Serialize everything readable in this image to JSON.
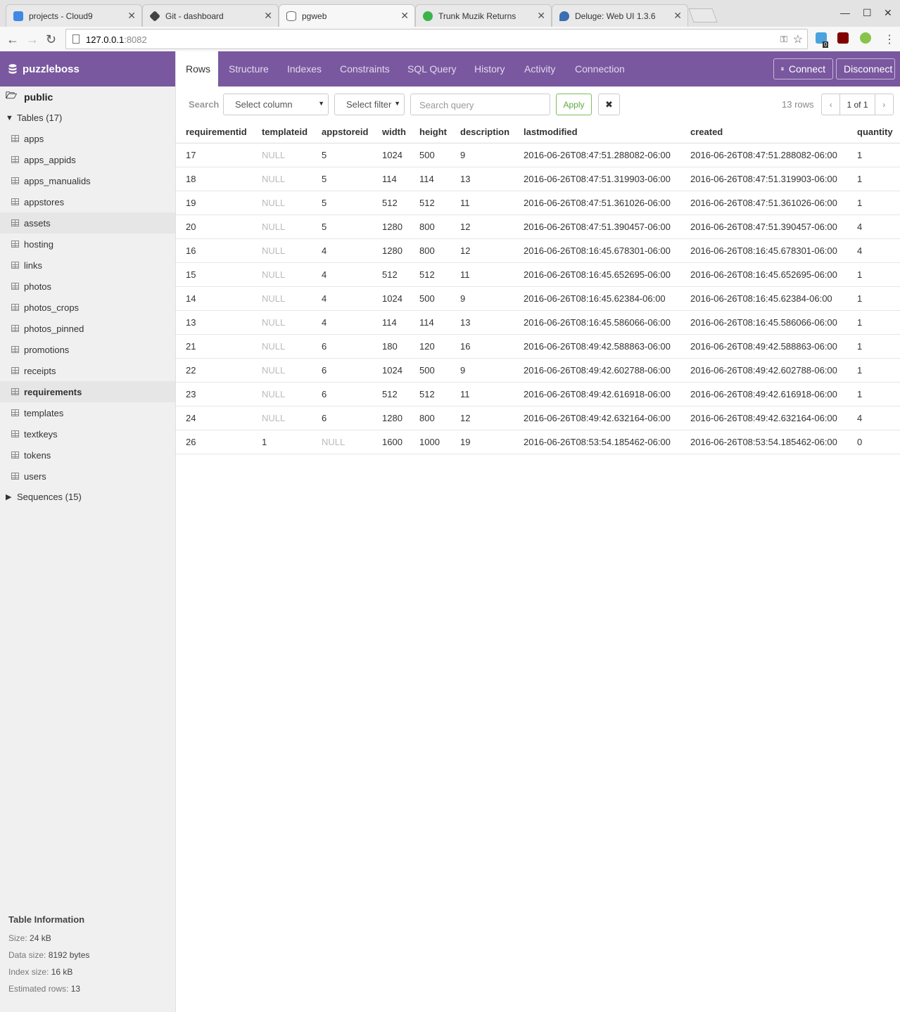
{
  "browser": {
    "tabs": [
      {
        "title": "projects - Cloud9",
        "icon": "cloud9-icon",
        "color": "#3f88e6"
      },
      {
        "title": "Git - dashboard",
        "icon": "git-icon",
        "color": "#444444"
      },
      {
        "title": "pgweb",
        "icon": "database-icon",
        "color": "#666666"
      },
      {
        "title": "Trunk Muzik Returns",
        "icon": "play-icon",
        "color": "#3cb44b"
      },
      {
        "title": "Deluge: Web UI 1.3.6",
        "icon": "deluge-icon",
        "color": "#3a6fb0"
      }
    ],
    "url_host": "127.0.0.1",
    "url_port": ":8082",
    "ext_badge": "0"
  },
  "sidebar": {
    "database": "puzzleboss",
    "schema": "public",
    "tables_label": "Tables (17)",
    "tables": [
      "apps",
      "apps_appids",
      "apps_manualids",
      "appstores",
      "assets",
      "hosting",
      "links",
      "photos",
      "photos_crops",
      "photos_pinned",
      "promotions",
      "receipts",
      "requirements",
      "templates",
      "textkeys",
      "tokens",
      "users"
    ],
    "selected_table": "requirements",
    "sequences_label": "Sequences (15)",
    "info": {
      "title": "Table Information",
      "size_label": "Size:",
      "size": "24 kB",
      "data_size_label": "Data size:",
      "data_size": "8192 bytes",
      "index_size_label": "Index size:",
      "index_size": "16 kB",
      "est_rows_label": "Estimated rows:",
      "est_rows": "13"
    }
  },
  "nav": {
    "tabs": [
      "Rows",
      "Structure",
      "Indexes",
      "Constraints",
      "SQL Query",
      "History",
      "Activity",
      "Connection"
    ],
    "active": "Rows",
    "connect_label": "Connect",
    "disconnect_label": "Disconnect"
  },
  "search": {
    "label": "Search",
    "column_select": "Select column",
    "filter_select": "Select filter",
    "query_placeholder": "Search query",
    "apply_label": "Apply",
    "clear_icon": "✖",
    "row_count": "13 rows",
    "page_info": "1 of 1"
  },
  "table": {
    "columns": [
      "requirementid",
      "templateid",
      "appstoreid",
      "width",
      "height",
      "description",
      "lastmodified",
      "created",
      "quantity"
    ],
    "rows": [
      [
        "17",
        "NULL",
        "5",
        "1024",
        "500",
        "9",
        "2016-06-26T08:47:51.288082-06:00",
        "2016-06-26T08:47:51.288082-06:00",
        "1"
      ],
      [
        "18",
        "NULL",
        "5",
        "114",
        "114",
        "13",
        "2016-06-26T08:47:51.319903-06:00",
        "2016-06-26T08:47:51.319903-06:00",
        "1"
      ],
      [
        "19",
        "NULL",
        "5",
        "512",
        "512",
        "11",
        "2016-06-26T08:47:51.361026-06:00",
        "2016-06-26T08:47:51.361026-06:00",
        "1"
      ],
      [
        "20",
        "NULL",
        "5",
        "1280",
        "800",
        "12",
        "2016-06-26T08:47:51.390457-06:00",
        "2016-06-26T08:47:51.390457-06:00",
        "4"
      ],
      [
        "16",
        "NULL",
        "4",
        "1280",
        "800",
        "12",
        "2016-06-26T08:16:45.678301-06:00",
        "2016-06-26T08:16:45.678301-06:00",
        "4"
      ],
      [
        "15",
        "NULL",
        "4",
        "512",
        "512",
        "11",
        "2016-06-26T08:16:45.652695-06:00",
        "2016-06-26T08:16:45.652695-06:00",
        "1"
      ],
      [
        "14",
        "NULL",
        "4",
        "1024",
        "500",
        "9",
        "2016-06-26T08:16:45.62384-06:00",
        "2016-06-26T08:16:45.62384-06:00",
        "1"
      ],
      [
        "13",
        "NULL",
        "4",
        "114",
        "114",
        "13",
        "2016-06-26T08:16:45.586066-06:00",
        "2016-06-26T08:16:45.586066-06:00",
        "1"
      ],
      [
        "21",
        "NULL",
        "6",
        "180",
        "120",
        "16",
        "2016-06-26T08:49:42.588863-06:00",
        "2016-06-26T08:49:42.588863-06:00",
        "1"
      ],
      [
        "22",
        "NULL",
        "6",
        "1024",
        "500",
        "9",
        "2016-06-26T08:49:42.602788-06:00",
        "2016-06-26T08:49:42.602788-06:00",
        "1"
      ],
      [
        "23",
        "NULL",
        "6",
        "512",
        "512",
        "11",
        "2016-06-26T08:49:42.616918-06:00",
        "2016-06-26T08:49:42.616918-06:00",
        "1"
      ],
      [
        "24",
        "NULL",
        "6",
        "1280",
        "800",
        "12",
        "2016-06-26T08:49:42.632164-06:00",
        "2016-06-26T08:49:42.632164-06:00",
        "4"
      ],
      [
        "26",
        "1",
        "NULL",
        "1600",
        "1000",
        "19",
        "2016-06-26T08:53:54.185462-06:00",
        "2016-06-26T08:53:54.185462-06:00",
        "0"
      ]
    ]
  },
  "colors": {
    "brand": "#79589f",
    "apply": "#5fa83d",
    "null_text": "#bbbbbb"
  }
}
